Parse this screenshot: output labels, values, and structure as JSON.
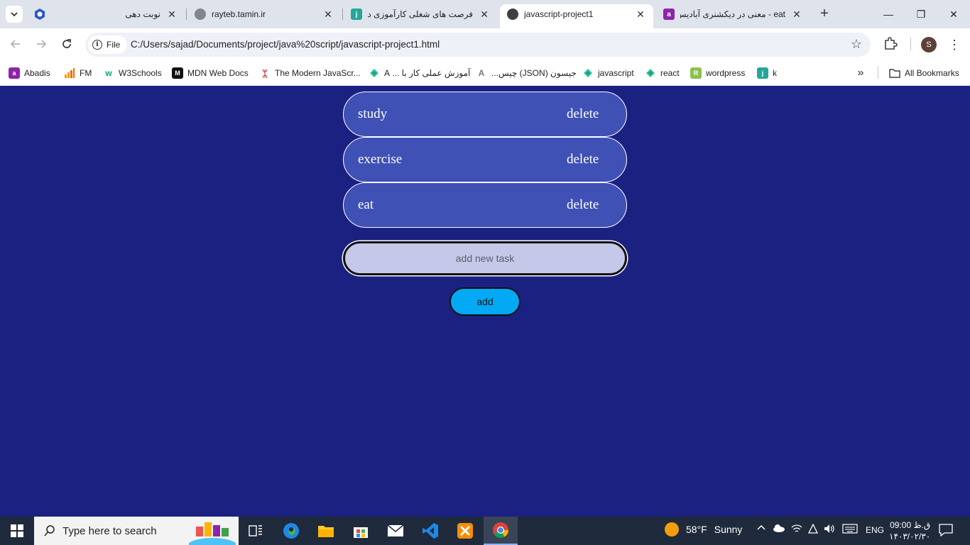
{
  "browser": {
    "tabs": [
      {
        "title": "نوبت دهی",
        "close": "✕"
      },
      {
        "title": "rayteb.tamin.ir",
        "close": "✕"
      },
      {
        "title": "فرصت های شغلی کارآموزی د",
        "close": "✕"
      },
      {
        "title": "javascript-project1",
        "close": "✕",
        "active": true
      },
      {
        "title": "eat - معنی در دیکشنری آبادیس",
        "close": "✕"
      }
    ],
    "new_tab": "+",
    "window_controls": {
      "minimize": "—",
      "restore": "❐",
      "close": "✕"
    },
    "chip_label": "File",
    "url": "C:/Users/sajad/Documents/project/java%20script/javascript-project1.html",
    "profile_initial": "S",
    "bookmarks": [
      {
        "label": "Abadis"
      },
      {
        "label": "FM"
      },
      {
        "label": "W3Schools"
      },
      {
        "label": "MDN Web Docs"
      },
      {
        "label": "The Modern JavaScr..."
      },
      {
        "label": "آموزش عملی کار با ... A"
      },
      {
        "label": "جیسون (JSON) چیس..."
      },
      {
        "label": "javascript"
      },
      {
        "label": "react"
      },
      {
        "label": "wordpress"
      },
      {
        "label": "k"
      }
    ],
    "all_bookmarks": "All Bookmarks"
  },
  "app": {
    "tasks": [
      {
        "name": "study",
        "delete_label": "delete"
      },
      {
        "name": "exercise",
        "delete_label": "delete"
      },
      {
        "name": "eat",
        "delete_label": "delete"
      }
    ],
    "input_placeholder": "add new task",
    "add_label": "add"
  },
  "taskbar": {
    "search_placeholder": "Type here to search",
    "weather_temp": "58°F",
    "weather_text": "Sunny",
    "language": "ENG",
    "time": "ق.ظ 09:00",
    "date": "۱۴۰۳/۰۲/۳۰"
  },
  "colors": {
    "page_background": "#1b2180",
    "task_background": "#3f51b5",
    "add_button": "#03a9f4",
    "input_background": "#c5c8e8"
  }
}
